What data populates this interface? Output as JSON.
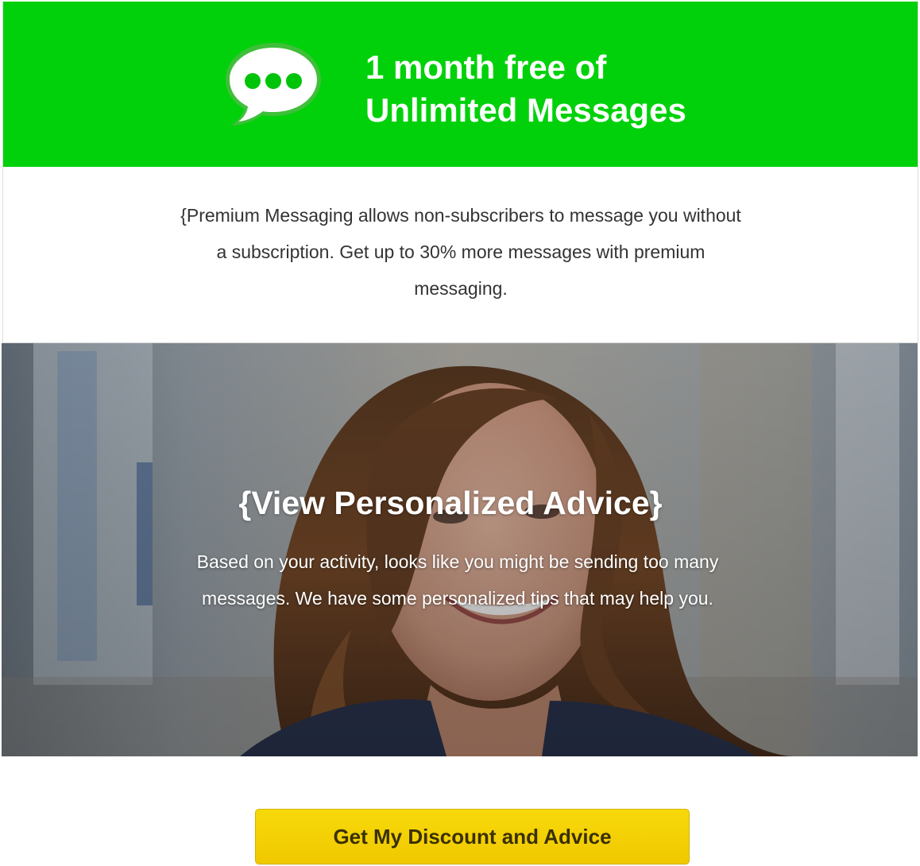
{
  "hero": {
    "title_line1": "1 month free of",
    "title_line2": "Unlimited Messages",
    "icon": "chat-bubble-icon",
    "background_color": "#00d10a"
  },
  "intro": {
    "text": "{Premium Messaging allows non-subscribers to message you without a subscription. Get up to 30% more messages with premium messaging."
  },
  "advice": {
    "title": "{View Personalized Advice}",
    "body": "Based on your activity, looks like you might be sending too many messages. We have some personalized tips that may help you."
  },
  "cta": {
    "label": "Get My Discount and Advice",
    "color": "#f5d20a"
  }
}
